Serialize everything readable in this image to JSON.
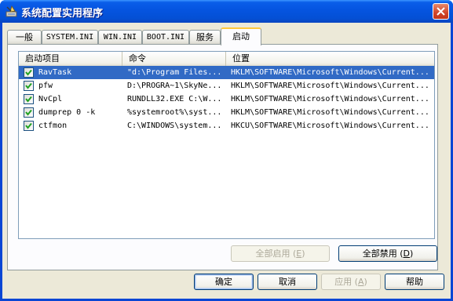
{
  "window": {
    "title": "系统配置实用程序",
    "icon": "msconfig-icon"
  },
  "tabs": [
    {
      "label": "一般",
      "active": false
    },
    {
      "label": "SYSTEM.INI",
      "active": false
    },
    {
      "label": "WIN.INI",
      "active": false
    },
    {
      "label": "BOOT.INI",
      "active": false
    },
    {
      "label": "服务",
      "active": false
    },
    {
      "label": "启动",
      "active": true
    }
  ],
  "startup_list": {
    "columns": [
      "启动项目",
      "命令",
      "位置"
    ],
    "rows": [
      {
        "checked": true,
        "item": "RavTask",
        "command": "\"d:\\Program Files...",
        "location": "HKLM\\SOFTWARE\\Microsoft\\Windows\\Current...",
        "selected": true
      },
      {
        "checked": true,
        "item": "pfw",
        "command": "D:\\PROGRA~1\\SkyNe...",
        "location": "HKLM\\SOFTWARE\\Microsoft\\Windows\\Current...",
        "selected": false
      },
      {
        "checked": true,
        "item": "NvCpl",
        "command": "RUNDLL32.EXE C:\\W...",
        "location": "HKLM\\SOFTWARE\\Microsoft\\Windows\\Current...",
        "selected": false
      },
      {
        "checked": true,
        "item": "dumprep 0 -k",
        "command": "%systemroot%\\syst...",
        "location": "HKLM\\SOFTWARE\\Microsoft\\Windows\\Current...",
        "selected": false
      },
      {
        "checked": true,
        "item": "ctfmon",
        "command": "C:\\WINDOWS\\system...",
        "location": "HKCU\\SOFTWARE\\Microsoft\\Windows\\Current...",
        "selected": false
      }
    ]
  },
  "panel_buttons": {
    "enable_all": {
      "label": "全部启用",
      "mnemonic": "E",
      "enabled": false
    },
    "disable_all": {
      "label": "全部禁用",
      "mnemonic": "D",
      "enabled": true
    }
  },
  "dialog_buttons": {
    "ok": "确定",
    "cancel": "取消",
    "apply": {
      "label": "应用",
      "mnemonic": "A",
      "enabled": false
    },
    "help": "帮助"
  },
  "colors": {
    "titlebar": "#0554e0",
    "selection": "#316ac5",
    "dialog_bg": "#ece9d8",
    "active_tab_accent": "#ffc83c"
  }
}
